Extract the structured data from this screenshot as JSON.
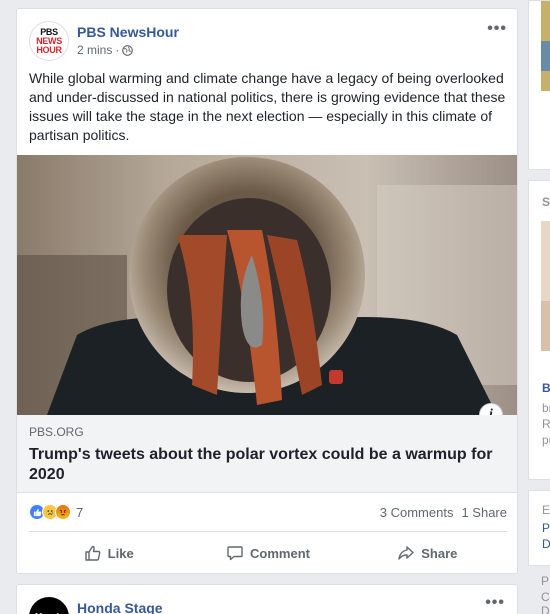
{
  "post": {
    "page_name": "PBS NewsHour",
    "avatar": {
      "line1": "PBS",
      "line2": "NEWS",
      "line3": "HOUR"
    },
    "time": "2 mins",
    "privacy_icon": "globe-icon",
    "more_label": "•••",
    "text": "While global warming and climate change have a legacy of being overlooked and under-discussed in national politics, there is growing evidence that these issues will take the stage in the next election — especially in this climate of partisan politics.",
    "link": {
      "info_label": "i",
      "domain": "PBS.ORG",
      "title": "Trump's tweets about the polar vortex could be a warmup for 2020"
    },
    "reaction_count": "7",
    "reactions": [
      "like",
      "sad",
      "angry"
    ],
    "comments": "3 Comments",
    "shares": "1 Share",
    "actions": {
      "like": "Like",
      "comment": "Comment",
      "share": "Share"
    }
  },
  "next_post": {
    "page_name": "Honda Stage",
    "avatar_text": "Honda",
    "more_label": "•••"
  },
  "right_column": {
    "sponsored_initial": "S",
    "lines": [
      "B",
      "br",
      "R",
      "pu",
      "E",
      "P",
      "D",
      "P",
      "C",
      "D"
    ]
  },
  "colors": {
    "link_blue": "#365899",
    "like_blue": "#4080ff",
    "page_bg": "#e9ebee"
  }
}
